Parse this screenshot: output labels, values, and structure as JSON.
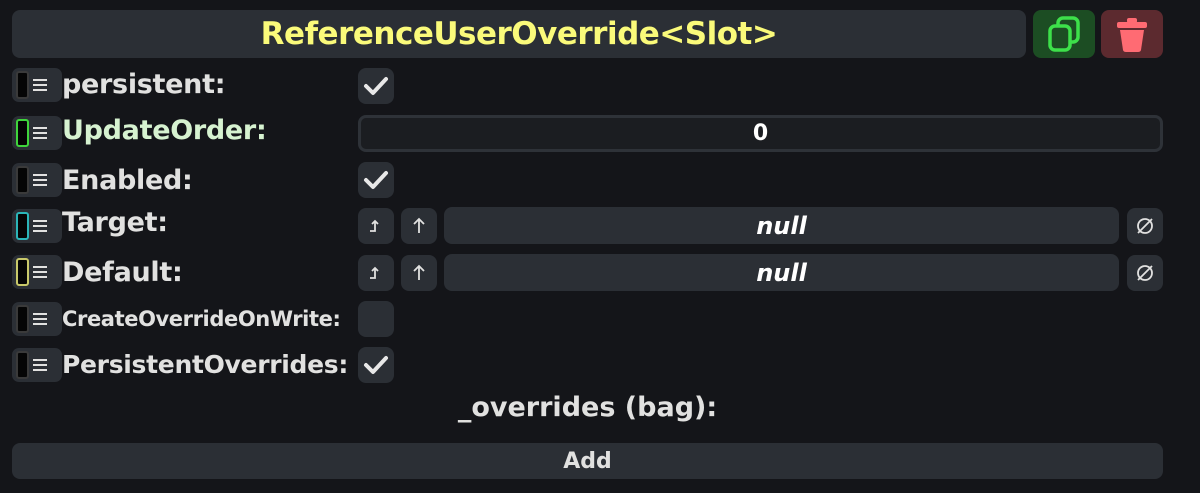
{
  "header": {
    "title": "ReferenceUserOverride<Slot>",
    "duplicate_icon": "duplicate-icon",
    "delete_icon": "trash-icon"
  },
  "fields": {
    "persistent": {
      "label": "persistent:",
      "checked": true
    },
    "update_order": {
      "label": "UpdateOrder:",
      "value": "0"
    },
    "enabled": {
      "label": "Enabled:",
      "checked": true
    },
    "target": {
      "label": "Target:",
      "value": "null",
      "jump_icon": "jump-to-icon",
      "up_icon": "arrow-up-icon",
      "clear_icon": "null-icon"
    },
    "default": {
      "label": "Default:",
      "value": "null",
      "jump_icon": "jump-to-icon",
      "up_icon": "arrow-up-icon",
      "clear_icon": "null-icon"
    },
    "create_override_on_write": {
      "label": "CreateOverrideOnWrite:",
      "checked": false
    },
    "persistent_overrides": {
      "label": "PersistentOverrides:",
      "checked": true
    }
  },
  "overrides": {
    "label": "_overrides (bag):",
    "add_label": "Add"
  },
  "colors": {
    "title": "#fafa7a",
    "duplicate_button": "#1c4d23",
    "delete_button": "#5c2a2f",
    "panel": "#2b2f35",
    "background": "#141519"
  }
}
